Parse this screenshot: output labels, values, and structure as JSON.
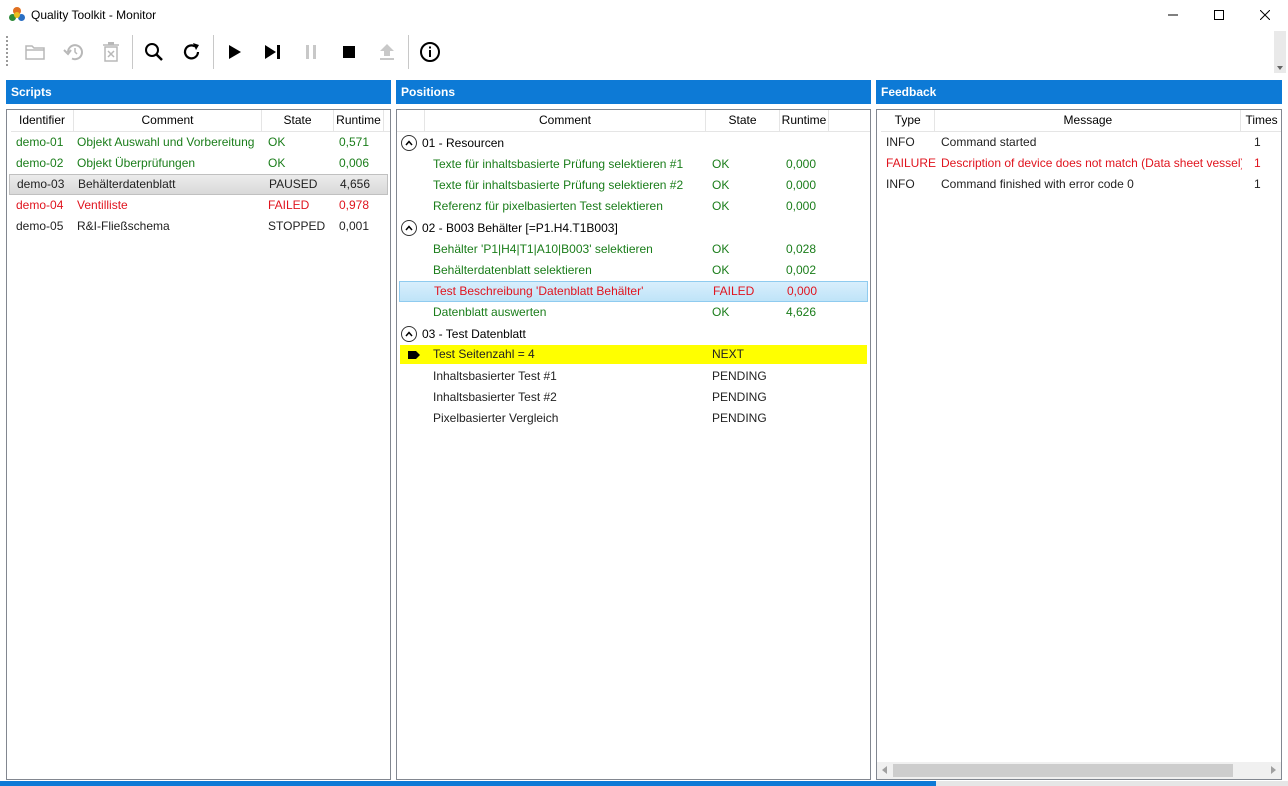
{
  "window": {
    "title": "Quality Toolkit - Monitor"
  },
  "toolbar": {
    "buttons": [
      {
        "icon": "folder-icon",
        "enabled": false
      },
      {
        "icon": "restore-icon",
        "enabled": false
      },
      {
        "icon": "delete-icon",
        "enabled": false
      },
      {
        "icon": "search-icon",
        "enabled": true
      },
      {
        "icon": "refresh-icon",
        "enabled": true
      },
      {
        "icon": "play-icon",
        "enabled": true
      },
      {
        "icon": "step-icon",
        "enabled": true
      },
      {
        "icon": "pause-icon",
        "enabled": false
      },
      {
        "icon": "stop-icon",
        "enabled": true
      },
      {
        "icon": "upload-icon",
        "enabled": false
      },
      {
        "icon": "info-icon",
        "enabled": true
      }
    ]
  },
  "scripts": {
    "header": "Scripts",
    "columns": [
      "Identifier",
      "Comment",
      "State",
      "Runtime"
    ],
    "rows": [
      {
        "id": "demo-01",
        "comment": "Objekt Auswahl und Vorbereitung",
        "state": "OK",
        "runtime": "0,571"
      },
      {
        "id": "demo-02",
        "comment": "Objekt Überprüfungen",
        "state": "OK",
        "runtime": "0,006"
      },
      {
        "id": "demo-03",
        "comment": "Behälterdatenblatt",
        "state": "PAUSED",
        "runtime": "4,656"
      },
      {
        "id": "demo-04",
        "comment": "Ventilliste",
        "state": "FAILED",
        "runtime": "0,978"
      },
      {
        "id": "demo-05",
        "comment": "R&I-Fließschema",
        "state": "STOPPED",
        "runtime": "0,001"
      }
    ]
  },
  "positions": {
    "header": "Positions",
    "columns": [
      "Comment",
      "State",
      "Runtime"
    ],
    "groups": [
      {
        "title": "01 - Resourcen",
        "items": [
          {
            "comment": "Texte für inhaltsbasierte Prüfung selektieren #1",
            "state": "OK",
            "runtime": "0,000"
          },
          {
            "comment": "Texte für inhaltsbasierte Prüfung selektieren #2",
            "state": "OK",
            "runtime": "0,000"
          },
          {
            "comment": "Referenz für pixelbasierten Test selektieren",
            "state": "OK",
            "runtime": "0,000"
          }
        ]
      },
      {
        "title": "02 - B003 Behälter [=P1.H4.T1B003]",
        "items": [
          {
            "comment": "Behälter 'P1|H4|T1|A10|B003' selektieren",
            "state": "OK",
            "runtime": "0,028"
          },
          {
            "comment": "Behälterdatenblatt selektieren",
            "state": "OK",
            "runtime": "0,002"
          },
          {
            "comment": "Test Beschreibung 'Datenblatt Behälter'",
            "state": "FAILED",
            "runtime": "0,000"
          },
          {
            "comment": "Datenblatt auswerten",
            "state": "OK",
            "runtime": "4,626"
          }
        ]
      },
      {
        "title": "03 - Test Datenblatt",
        "items": [
          {
            "comment": "Test Seitenzahl = 4",
            "state": "NEXT",
            "runtime": ""
          },
          {
            "comment": "Inhaltsbasierter Test #1",
            "state": "PENDING",
            "runtime": ""
          },
          {
            "comment": "Inhaltsbasierter Test #2",
            "state": "PENDING",
            "runtime": ""
          },
          {
            "comment": "Pixelbasierter Vergleich",
            "state": "PENDING",
            "runtime": ""
          }
        ]
      }
    ]
  },
  "feedback": {
    "header": "Feedback",
    "columns": [
      "Type",
      "Message",
      "Times"
    ],
    "rows": [
      {
        "type": "INFO",
        "message": "Command started",
        "times": "1"
      },
      {
        "type": "FAILURE",
        "message": "Description of device does not match (Data sheet vessel)",
        "times": "1"
      },
      {
        "type": "INFO",
        "message": "Command finished with error code 0",
        "times": "1"
      }
    ]
  },
  "progress": {
    "value": 0.727
  },
  "colors": {
    "accent": "#0d7ad6",
    "ok": "#1a7d1a",
    "failed": "#e0141e",
    "next": "#ffff00"
  }
}
